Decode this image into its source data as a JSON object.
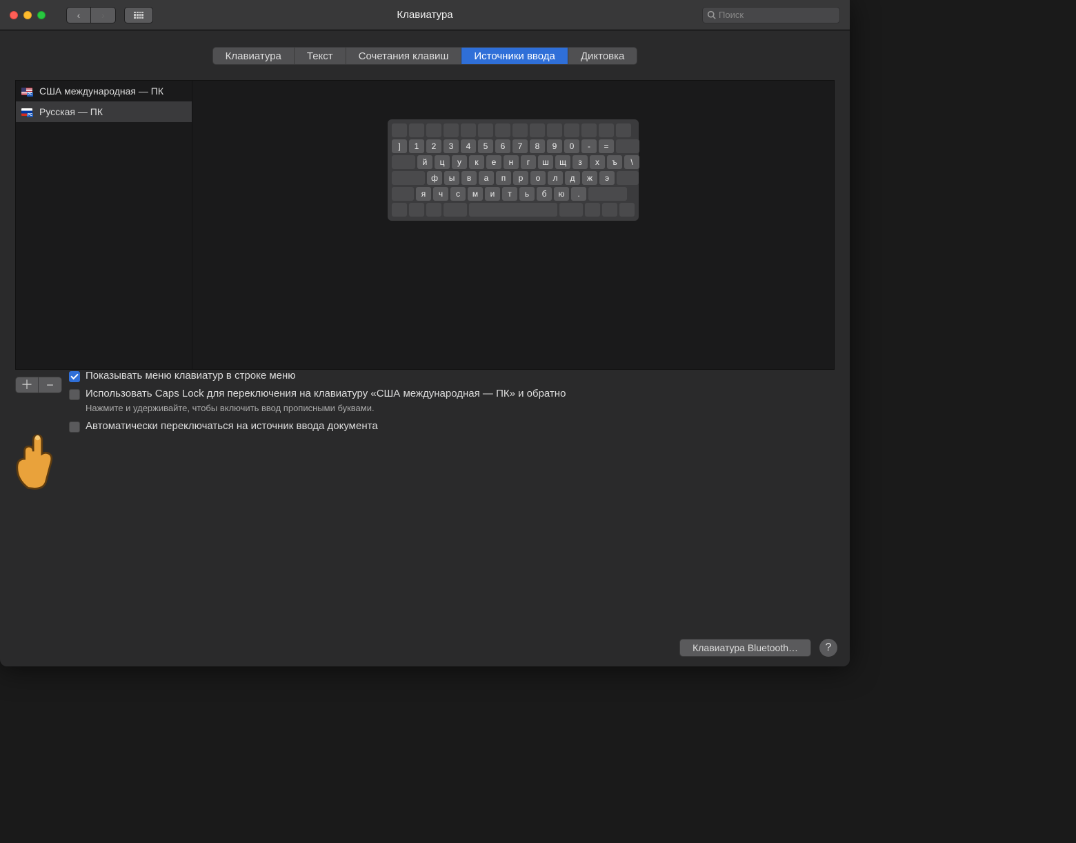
{
  "window": {
    "title": "Клавиатура"
  },
  "search": {
    "placeholder": "Поиск"
  },
  "tabs": [
    "Клавиатура",
    "Текст",
    "Сочетания клавиш",
    "Источники ввода",
    "Диктовка"
  ],
  "active_tab_index": 3,
  "sources": [
    {
      "label": "США международная — ПК",
      "flag": "us"
    },
    {
      "label": "Русская — ПК",
      "flag": "ru"
    }
  ],
  "selected_source_index": 1,
  "keyboard_rows": [
    [
      "]",
      "1",
      "2",
      "3",
      "4",
      "5",
      "6",
      "7",
      "8",
      "9",
      "0",
      "-",
      "="
    ],
    [
      "й",
      "ц",
      "у",
      "к",
      "е",
      "н",
      "г",
      "ш",
      "щ",
      "з",
      "х",
      "ъ",
      "\\"
    ],
    [
      "ф",
      "ы",
      "в",
      "а",
      "п",
      "р",
      "о",
      "л",
      "д",
      "ж",
      "э"
    ],
    [
      "я",
      "ч",
      "с",
      "м",
      "и",
      "т",
      "ь",
      "б",
      "ю",
      "."
    ]
  ],
  "options": {
    "show_menu": {
      "checked": true,
      "label": "Показывать меню клавиатур в строке меню"
    },
    "caps_lock": {
      "checked": false,
      "label": "Использовать Caps Lock для переключения на клавиатуру «США международная — ПК» и обратно"
    },
    "caps_hint": "Нажмите и удерживайте, чтобы включить ввод прописными буквами.",
    "auto_switch": {
      "checked": false,
      "label": "Автоматически переключаться на источник ввода документа"
    }
  },
  "footer_button": "Клавиатура Bluetooth…"
}
